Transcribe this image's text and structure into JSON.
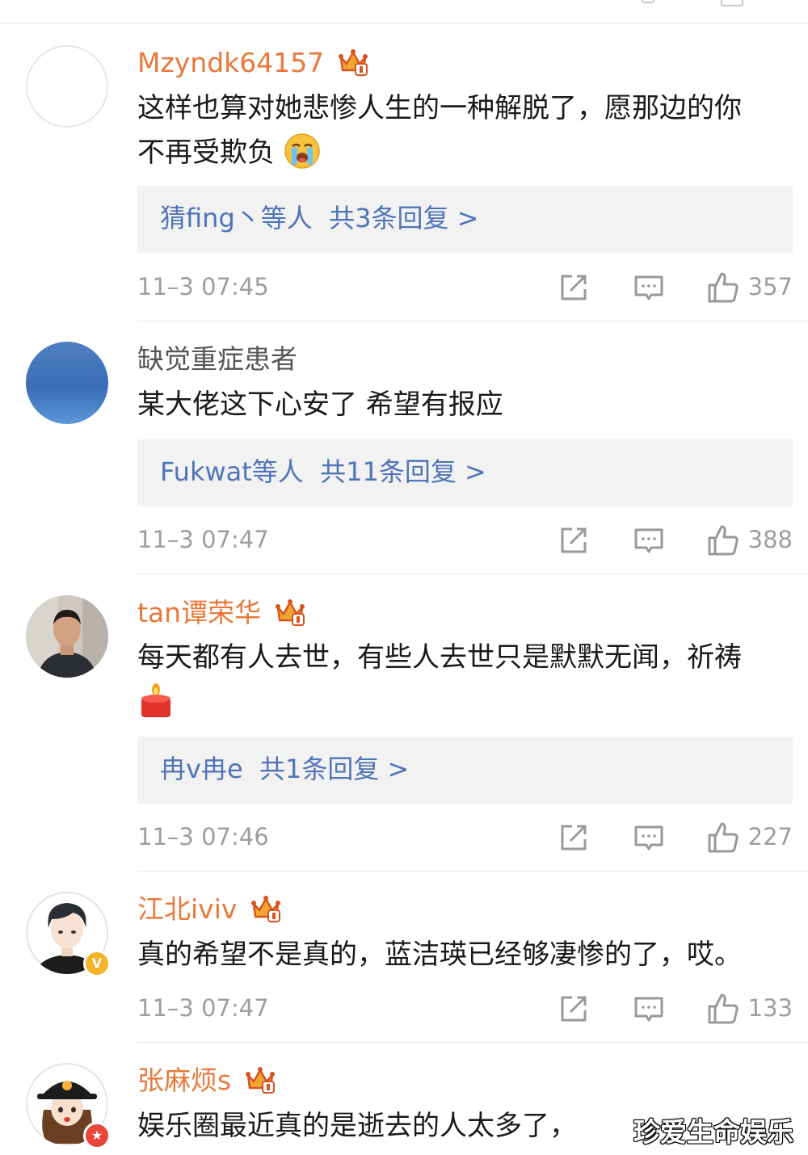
{
  "comments": [
    {
      "username": "Mzyndk64157",
      "text_lines": [
        "这样也算对她悲惨人生的一种解脱了，愿那边的你",
        "不再受欺负"
      ],
      "reply_who": "猜fing丶等人",
      "reply_count": "共3条回复 >",
      "time": "11–3 07:45",
      "likes": "357"
    },
    {
      "username": "缺觉重症患者",
      "text_lines": [
        "某大佬这下心安了  希望有报应"
      ],
      "reply_who": "Fukwat等人",
      "reply_count": "共11条回复 >",
      "time": "11–3 07:47",
      "likes": "388"
    },
    {
      "username": "tan谭荣华",
      "text_lines": [
        "每天都有人去世，有些人去世只是默默无闻，祈祷"
      ],
      "reply_who": "冉v冉e",
      "reply_count": "共1条回复 >",
      "time": "11–3 07:46",
      "likes": "227"
    },
    {
      "username": "江北iviv",
      "text_lines": [
        "真的希望不是真的，蓝洁瑛已经够凄惨的了，哎。"
      ],
      "time": "11–3 07:47",
      "likes": "133"
    },
    {
      "username": "张麻烦s",
      "text_lines": [
        "娱乐圈最近真的是逝去的人太多了，"
      ]
    }
  ],
  "watermark": "珍爱生命娱乐",
  "icons": {
    "crown": "vip-crown-icon",
    "share": "share-icon",
    "reply": "comment-icon",
    "like": "thumbs-up-icon",
    "emoji_cry": "crying-face-emoji",
    "emoji_candle": "candle-emoji",
    "verified": "verified-v-badge",
    "star_badge": "star-badge"
  },
  "colors": {
    "username_vip": "#e8793a",
    "reply_link": "#4f74b8",
    "reply_box_bg": "#f2f2f2",
    "meta_text": "#9e9e9e"
  }
}
